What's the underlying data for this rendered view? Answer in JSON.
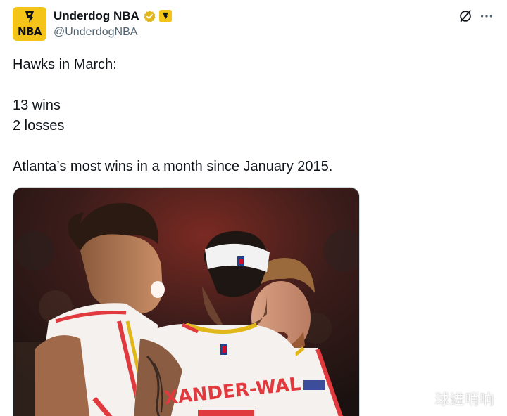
{
  "account": {
    "display_name": "Underdog NBA",
    "handle": "@UnderdogNBA",
    "avatar_text": "NBA"
  },
  "icons": {
    "verified": "verified-badge-icon",
    "affiliate": "underdog-affiliate-icon",
    "grok": "grok-icon",
    "more": "more-icon"
  },
  "tweet": {
    "lines": [
      "Hawks in March:",
      "",
      "13 wins",
      "2 losses",
      "",
      "Atlanta’s most wins in a month since January 2015."
    ]
  },
  "media": {
    "jersey_text": "XANDER-WAL"
  },
  "watermark": "球进哨响",
  "colors": {
    "brand_yellow": "#f4c518",
    "verified_gold": "#e2b719",
    "text": "#0f1419",
    "secondary": "#536471",
    "hawks_red": "#e03a3e"
  }
}
